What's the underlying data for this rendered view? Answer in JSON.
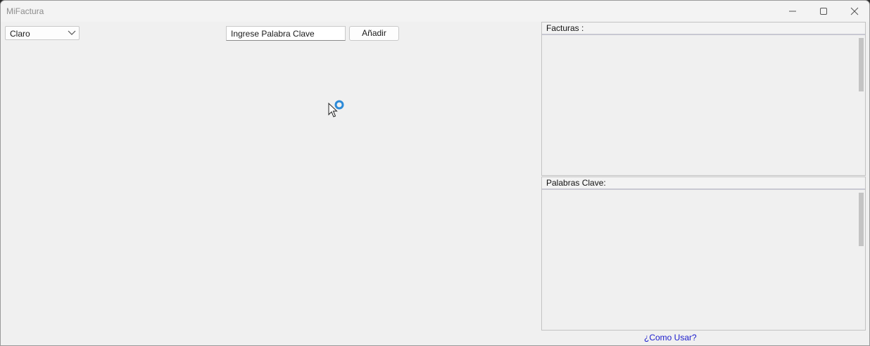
{
  "window": {
    "title": "MiFactura",
    "controls": [
      "minimize-icon",
      "maximize-icon",
      "close-icon"
    ]
  },
  "toolbar": {
    "theme_select": {
      "value": "Claro"
    },
    "keyword_input": {
      "value": "Ingrese Palabra Clave"
    },
    "add_label": "Añadir"
  },
  "invoices_panel": {
    "title": "Facturas :"
  },
  "keywords_panel": {
    "title": "Palabras Clave:"
  },
  "help_link": "¿Como Usar?",
  "colors": {
    "link": "#1a1acc",
    "busy_ring": "#2b8ad8"
  }
}
